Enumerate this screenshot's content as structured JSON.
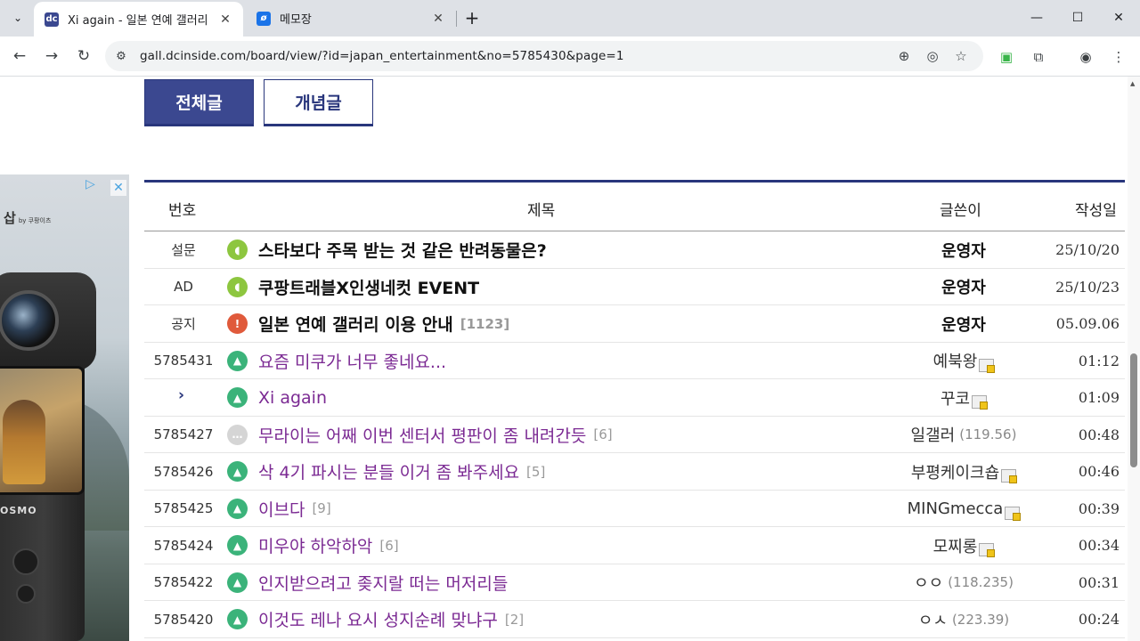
{
  "browser": {
    "tabs": [
      {
        "title": "Xi again - 일본 연예 갤러리",
        "favicon": "dc",
        "active": true
      },
      {
        "title": "메모장",
        "favicon": "memo",
        "active": false
      }
    ],
    "url": "gall.dcinside.com/board/view/?id=japan_entertainment&no=5785430&page=1"
  },
  "page": {
    "tab_buttons": {
      "all": "전체글",
      "concept": "개념글"
    },
    "ad": {
      "brand": "삽",
      "brand_sub": "by 쿠팡이츠",
      "camera_label": "OSMO"
    },
    "columns": {
      "num": "번호",
      "title": "제목",
      "writer": "글쓴이",
      "date": "작성일"
    },
    "rows": [
      {
        "num": "설문",
        "icon": "speaker",
        "title": "스타보다 주목 받는 것 같은 반려동물은?",
        "reply": "",
        "writer": "운영자",
        "ip": "",
        "date": "25/10/20",
        "bold": true
      },
      {
        "num": "AD",
        "icon": "speaker",
        "title": "쿠팡트래블X인생네컷 EVENT",
        "reply": "",
        "writer": "운영자",
        "ip": "",
        "date": "25/10/23",
        "bold": true
      },
      {
        "num": "공지",
        "icon": "notice",
        "title": "일본 연예 갤러리 이용 안내",
        "reply": "[1123]",
        "writer": "운영자",
        "ip": "",
        "date": "05.09.06",
        "bold": true
      },
      {
        "num": "5785431",
        "icon": "picture",
        "title": "요즘 미쿠가 너무 좋네요...",
        "reply": "",
        "writer": "예북왕",
        "ip": "",
        "date": "01:12",
        "badge": true
      },
      {
        "num": "",
        "icon": "picture",
        "title": "Xi again",
        "reply": "",
        "writer": "꾸코",
        "ip": "",
        "date": "01:09",
        "badge": true,
        "current": true
      },
      {
        "num": "5785427",
        "icon": "chat",
        "title": "무라이는 어째 이번 센터서 평판이 좀 내려간듯",
        "reply": "[6]",
        "writer": "일갤러",
        "ip": "(119.56)",
        "date": "00:48"
      },
      {
        "num": "5785426",
        "icon": "picture",
        "title": "삭 4기 파시는 분들 이거 좀 봐주세요",
        "reply": "[5]",
        "writer": "부평케이크숍",
        "ip": "",
        "date": "00:46",
        "badge": true
      },
      {
        "num": "5785425",
        "icon": "picture",
        "title": "이브다",
        "reply": "[9]",
        "writer": "MINGmecca",
        "ip": "",
        "date": "00:39",
        "badge": true
      },
      {
        "num": "5785424",
        "icon": "picture",
        "title": "미우야 하악하악",
        "reply": "[6]",
        "writer": "모찌롱",
        "ip": "",
        "date": "00:34",
        "badge": true
      },
      {
        "num": "5785422",
        "icon": "picture",
        "title": "인지받으려고 좆지랄 떠는 머저리들",
        "reply": "",
        "writer": "ㅇㅇ",
        "ip": "(118.235)",
        "date": "00:31"
      },
      {
        "num": "5785420",
        "icon": "picture",
        "title": "이것도 레나 요시 성지순례 맞냐구",
        "reply": "[2]",
        "writer": "ㅇㅅ",
        "ip": "(223.39)",
        "date": "00:24"
      }
    ]
  }
}
